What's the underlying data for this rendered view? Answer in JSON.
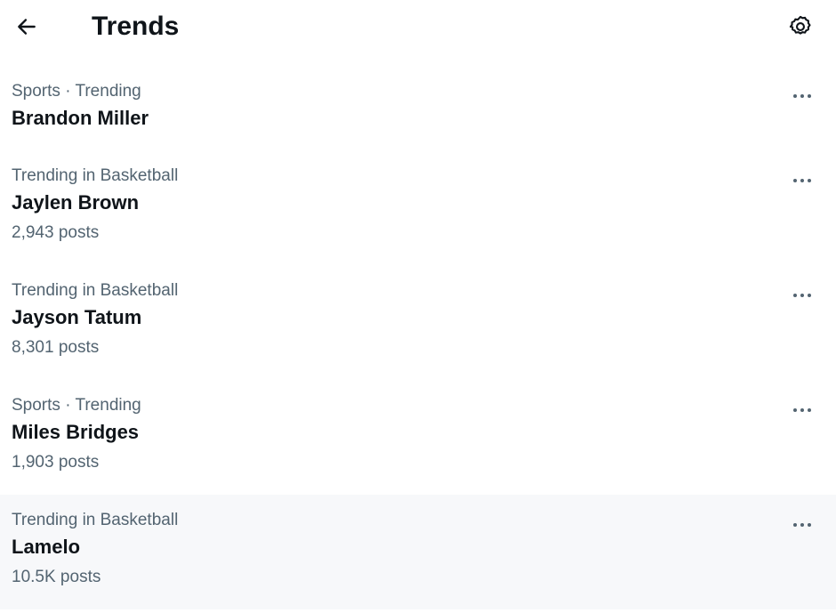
{
  "header": {
    "title": "Trends",
    "back_icon": "arrow-left-icon",
    "settings_icon": "gear-icon"
  },
  "trends": [
    {
      "context": "Sports · Trending",
      "name": "Brandon Miller",
      "posts": ""
    },
    {
      "context": "Trending in Basketball",
      "name": "Jaylen Brown",
      "posts": "2,943 posts"
    },
    {
      "context": "Trending in Basketball",
      "name": "Jayson Tatum",
      "posts": "8,301 posts"
    },
    {
      "context": "Sports · Trending",
      "name": "Miles Bridges",
      "posts": "1,903 posts"
    },
    {
      "context": "Trending in Basketball",
      "name": "Lamelo",
      "posts": "10.5K posts"
    }
  ],
  "colors": {
    "primary_text": "#0f1419",
    "secondary_text": "#536471",
    "hover_background": "#f7f8fa"
  }
}
